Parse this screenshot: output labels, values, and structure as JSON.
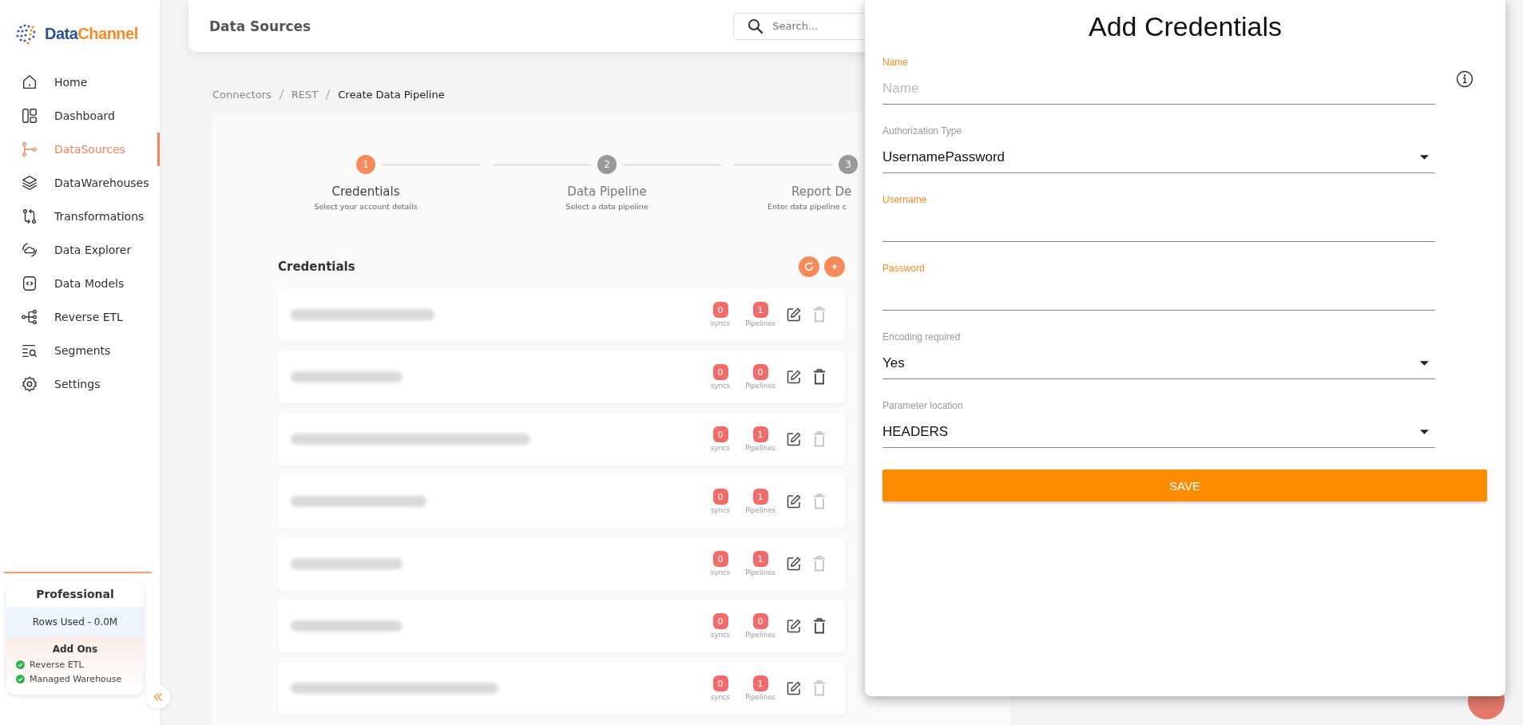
{
  "sidebar": {
    "logo": {
      "part1": "Data",
      "part2": "Channel"
    },
    "items": [
      {
        "label": "Home",
        "selected": false
      },
      {
        "label": "Dashboard",
        "selected": false
      },
      {
        "label": "DataSources",
        "selected": true
      },
      {
        "label": "DataWarehouses",
        "selected": false
      },
      {
        "label": "Transformations",
        "selected": false
      },
      {
        "label": "Data Explorer",
        "selected": false
      },
      {
        "label": "Data Models",
        "selected": false
      },
      {
        "label": "Reverse ETL",
        "selected": false
      },
      {
        "label": "Segments",
        "selected": false
      },
      {
        "label": "Settings",
        "selected": false
      }
    ],
    "plan": {
      "title": "Professional",
      "rows_used": "Rows Used - 0.0M",
      "addons_title": "Add Ons",
      "addons": [
        {
          "label": "Reverse ETL",
          "checked": true
        },
        {
          "label": "Managed Warehouse",
          "checked": true
        }
      ]
    }
  },
  "header": {
    "title": "Data Sources",
    "search": {
      "placeholder": "Search..."
    }
  },
  "breadcrumb": [
    {
      "label": "Connectors",
      "current": false
    },
    {
      "label": "REST",
      "current": false
    },
    {
      "label": "Create Data Pipeline",
      "current": true
    }
  ],
  "steps": [
    {
      "number": "1",
      "title": "Credentials",
      "subtitle": "Select your account details",
      "selected": true
    },
    {
      "number": "2",
      "title": "Data Pipeline",
      "subtitle": "Select a data pipeline",
      "selected": false
    },
    {
      "number": "3",
      "title": "Report De",
      "subtitle": "Enter data pipeline c",
      "selected": false
    }
  ],
  "credentials": {
    "title": "Credentials",
    "rows": [
      {
        "syncs": "0",
        "syncs_label": "syncs",
        "pipelines": "1",
        "pipelines_label": "Pipelines",
        "delete_disabled": true
      },
      {
        "syncs": "0",
        "syncs_label": "syncs",
        "pipelines": "0",
        "pipelines_label": "Pipelines",
        "delete_disabled": false
      },
      {
        "syncs": "0",
        "syncs_label": "syncs",
        "pipelines": "1",
        "pipelines_label": "Pipelines",
        "delete_disabled": true
      },
      {
        "syncs": "0",
        "syncs_label": "syncs",
        "pipelines": "1",
        "pipelines_label": "Pipelines",
        "delete_disabled": true
      },
      {
        "syncs": "0",
        "syncs_label": "syncs",
        "pipelines": "1",
        "pipelines_label": "Pipelines",
        "delete_disabled": true
      },
      {
        "syncs": "0",
        "syncs_label": "syncs",
        "pipelines": "0",
        "pipelines_label": "Pipelines",
        "delete_disabled": false
      },
      {
        "syncs": "0",
        "syncs_label": "syncs",
        "pipelines": "1",
        "pipelines_label": "Pipelines",
        "delete_disabled": true
      }
    ]
  },
  "dialog": {
    "title": "Add Credentials",
    "fields": [
      {
        "kind": "text",
        "label": "Name",
        "placeholder": "Name",
        "required": true
      },
      {
        "kind": "select",
        "label": "Authorization Type",
        "value": "UsernamePassword",
        "required": false
      },
      {
        "kind": "text",
        "label": "Username",
        "required": true
      },
      {
        "kind": "text",
        "label": "Password",
        "required": true
      },
      {
        "kind": "select",
        "label": "Encoding required",
        "value": "Yes",
        "required": false
      },
      {
        "kind": "select",
        "label": "Parameter location",
        "value": "HEADERS",
        "required": false
      }
    ],
    "save": "SAVE"
  }
}
